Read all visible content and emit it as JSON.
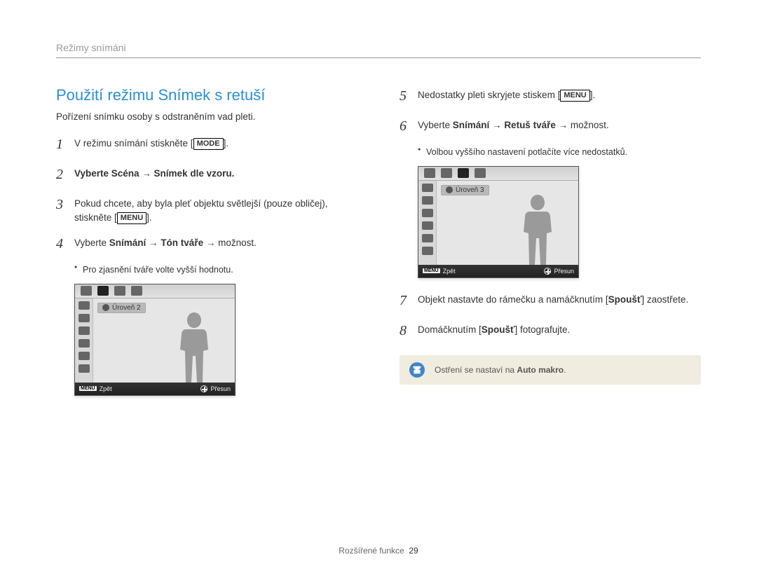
{
  "header": {
    "section": "Režimy snímáni"
  },
  "title": "Použití režimu Snímek s retuší",
  "intro": "Pořízení snímku osoby s odstraněním vad pleti.",
  "keys": {
    "mode": "MODE",
    "menu": "MENU"
  },
  "steps_left": [
    {
      "n": "1",
      "pre": "V režimu snímání stiskněte [",
      "key": "mode",
      "post": "]."
    },
    {
      "n": "2",
      "html_bold": "Vyberte Scéna → Snímek dle vzoru."
    },
    {
      "n": "3",
      "pre": "Pokud chcete, aby byla pleť objektu světlejší (pouze obličej), stiskněte [",
      "key": "menu",
      "post": "]."
    },
    {
      "n": "4",
      "parts": [
        "Vyberte ",
        "Snímání",
        " → ",
        "Tón tváře",
        " → možnost."
      ],
      "bullets": [
        "Pro zjasnění tváře volte vyšší hodnotu."
      ]
    }
  ],
  "lcd_left": {
    "level": "Úroveň 2",
    "back": "Zpět",
    "move": "Přesun",
    "menu_key": "MENU"
  },
  "steps_right": [
    {
      "n": "5",
      "pre": "Nedostatky pleti skryjete stiskem [",
      "key": "menu",
      "post": "]."
    },
    {
      "n": "6",
      "parts": [
        "Vyberte ",
        "Snímání",
        " → ",
        "Retuš tváře",
        " → možnost."
      ],
      "bullets": [
        "Volbou vyššího nastavení potlačíte více nedostatků."
      ]
    }
  ],
  "lcd_right": {
    "level": "Úroveň 3",
    "back": "Zpět",
    "move": "Přesun",
    "menu_key": "MENU"
  },
  "steps_right2": [
    {
      "n": "7",
      "parts_mixed": [
        "Objekt nastavte do rámečku a namáčknutím [",
        "Spoušť",
        "] zaostřete."
      ]
    },
    {
      "n": "8",
      "parts_mixed": [
        "Domáčknutím [",
        "Spoušť",
        "] fotografujte."
      ]
    }
  ],
  "note": {
    "pre": "Ostření se nastaví na ",
    "bold": "Auto makro",
    "post": "."
  },
  "footer": {
    "label": "Rozšířené funkce",
    "page": "29"
  }
}
